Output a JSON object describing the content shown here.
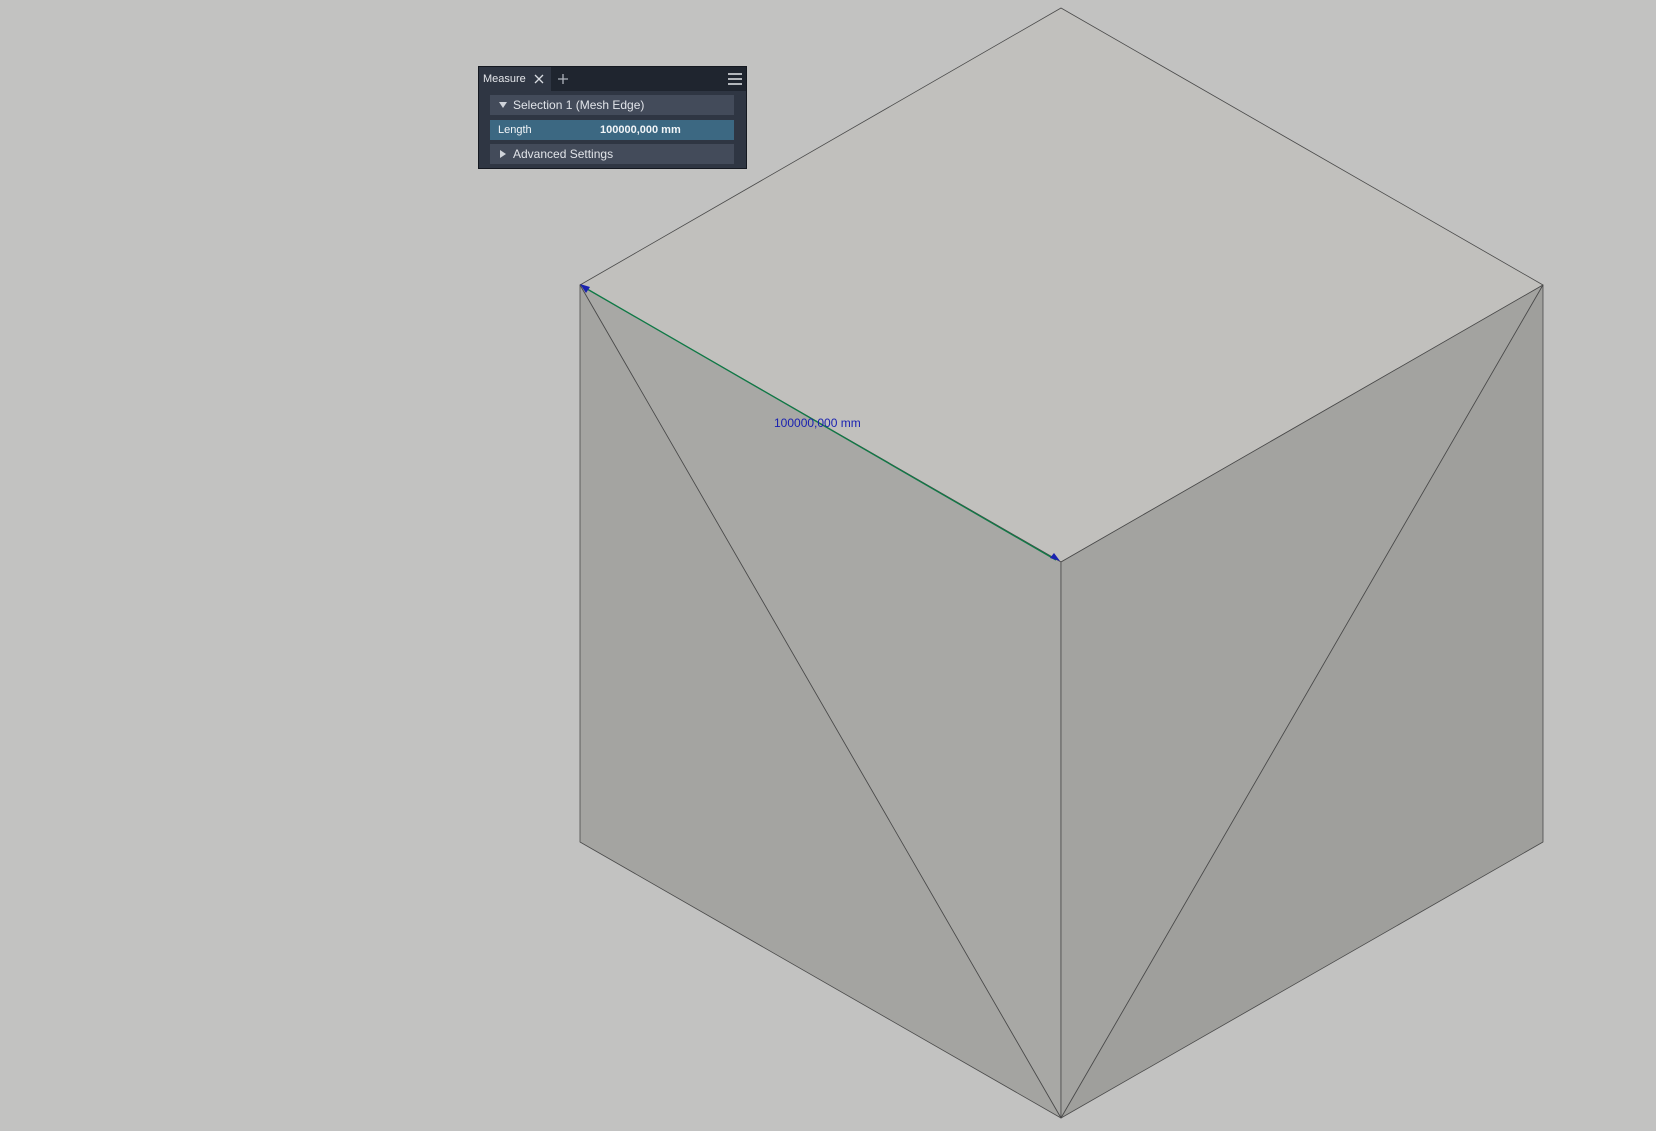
{
  "panel": {
    "tab_label": "Measure",
    "tab_close_icon": "close-icon",
    "add_tab_icon": "plus-icon",
    "menu_icon": "hamburger-menu-icon",
    "selection_label": "Selection 1 (Mesh Edge)",
    "length_label": "Length",
    "length_value": "100000,000 mm",
    "advanced_label": "Advanced Settings"
  },
  "viewport": {
    "measurement_label": "100000,000 mm",
    "background_color": "#c2c2c1",
    "measure_line_color": "#0f7a46",
    "measurement_text_color": "#1a22b0",
    "cube_top_color": "#c1c0bd",
    "cube_left_color": "#a6a6a3",
    "cube_right_color": "#a0a09d"
  }
}
